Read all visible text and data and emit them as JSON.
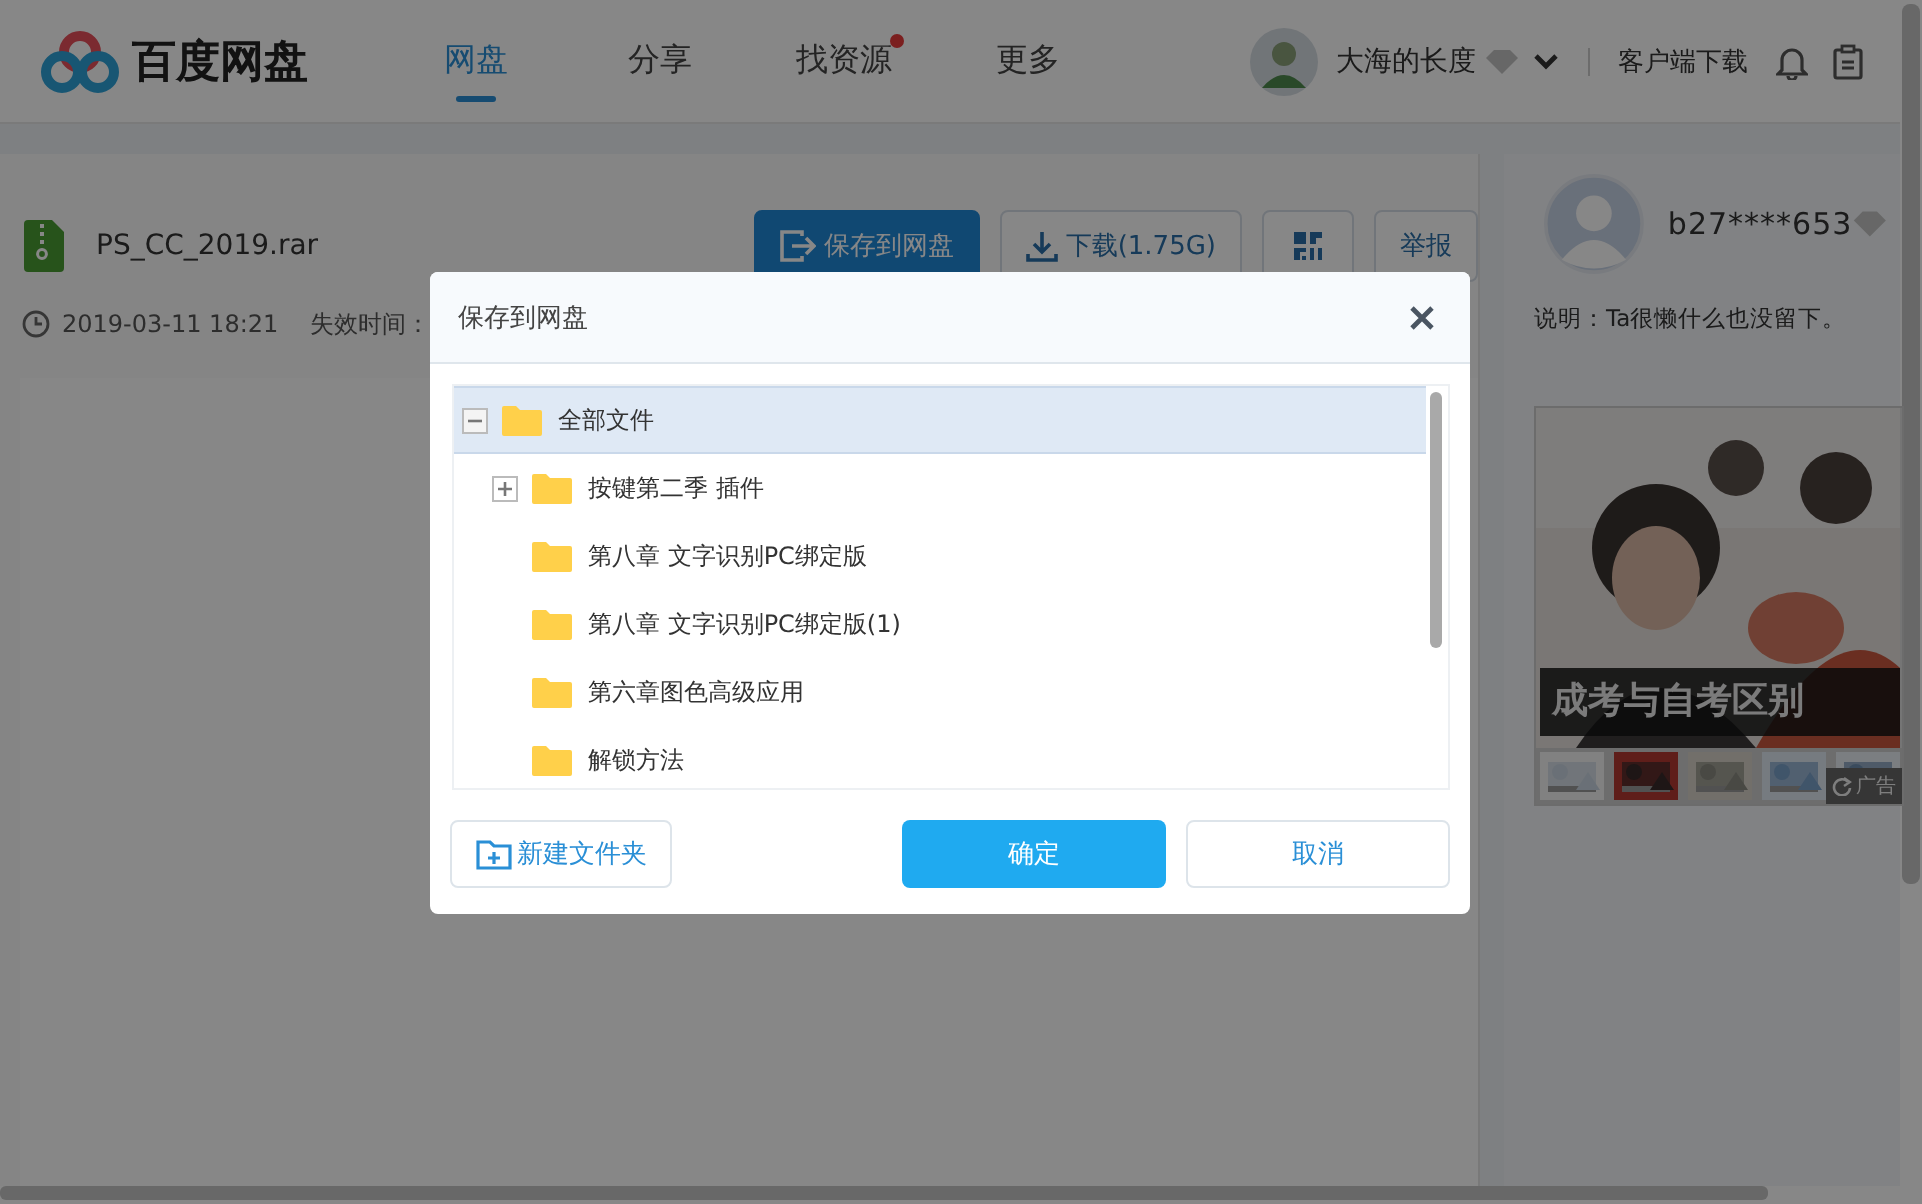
{
  "header": {
    "logo_text": "百度网盘",
    "nav": [
      {
        "label": "网盘",
        "selected": true,
        "dot": false
      },
      {
        "label": "分享",
        "selected": false,
        "dot": false
      },
      {
        "label": "找资源",
        "selected": false,
        "dot": true
      },
      {
        "label": "更多",
        "selected": false,
        "dot": false
      }
    ],
    "user_name": "大海的长度",
    "download_link": "客户端下载"
  },
  "file": {
    "name": "PS_CC_2019.rar",
    "time": "2019-03-11 18:21",
    "expiry_label": "失效时间：",
    "buttons": [
      {
        "kind": "primary",
        "label": "保存到网盘"
      },
      {
        "kind": "download",
        "label": "下载(1.75G)"
      },
      {
        "kind": "qr"
      },
      {
        "kind": "plain",
        "label": "举报"
      }
    ]
  },
  "sharer": {
    "name": "b27****653",
    "note": "说明：Ta很懒什么也没留下。",
    "ad": {
      "kind": "picture",
      "caption": "成考与自考区别",
      "badge": "广告"
    }
  },
  "dialog": {
    "title": "保存到网盘",
    "tree": [
      {
        "label": "全部文件",
        "kind": "branch",
        "expanded": true,
        "selected": true,
        "children": [
          {
            "label": "按键第二季 插件",
            "kind": "branch",
            "expanded": false,
            "selected": false
          },
          {
            "label": "第八章 文字识别PC绑定版",
            "kind": "leaf",
            "selected": false
          },
          {
            "label": "第八章 文字识别PC绑定版(1)",
            "kind": "leaf",
            "selected": false
          },
          {
            "label": "第六章图色高级应用",
            "kind": "leaf",
            "selected": false
          },
          {
            "label": "解锁方法",
            "kind": "leaf",
            "selected": false
          }
        ]
      }
    ],
    "new_folder": "新建文件夹",
    "confirm": "确定",
    "cancel": "取消"
  }
}
